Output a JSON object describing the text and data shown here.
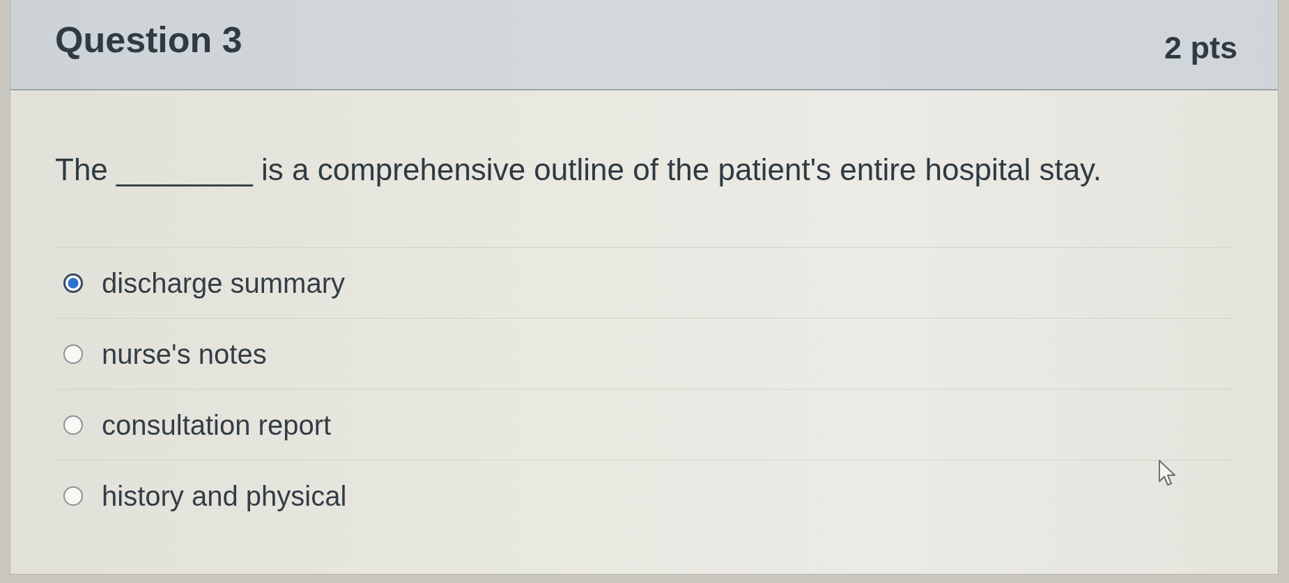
{
  "question": {
    "title": "Question 3",
    "points": "2 pts",
    "text": "The ________ is a comprehensive outline of the patient's entire hospital stay.",
    "options": [
      {
        "label": "discharge summary",
        "selected": true
      },
      {
        "label": "nurse's notes",
        "selected": false
      },
      {
        "label": "consultation report",
        "selected": false
      },
      {
        "label": "history and physical",
        "selected": false
      }
    ]
  }
}
